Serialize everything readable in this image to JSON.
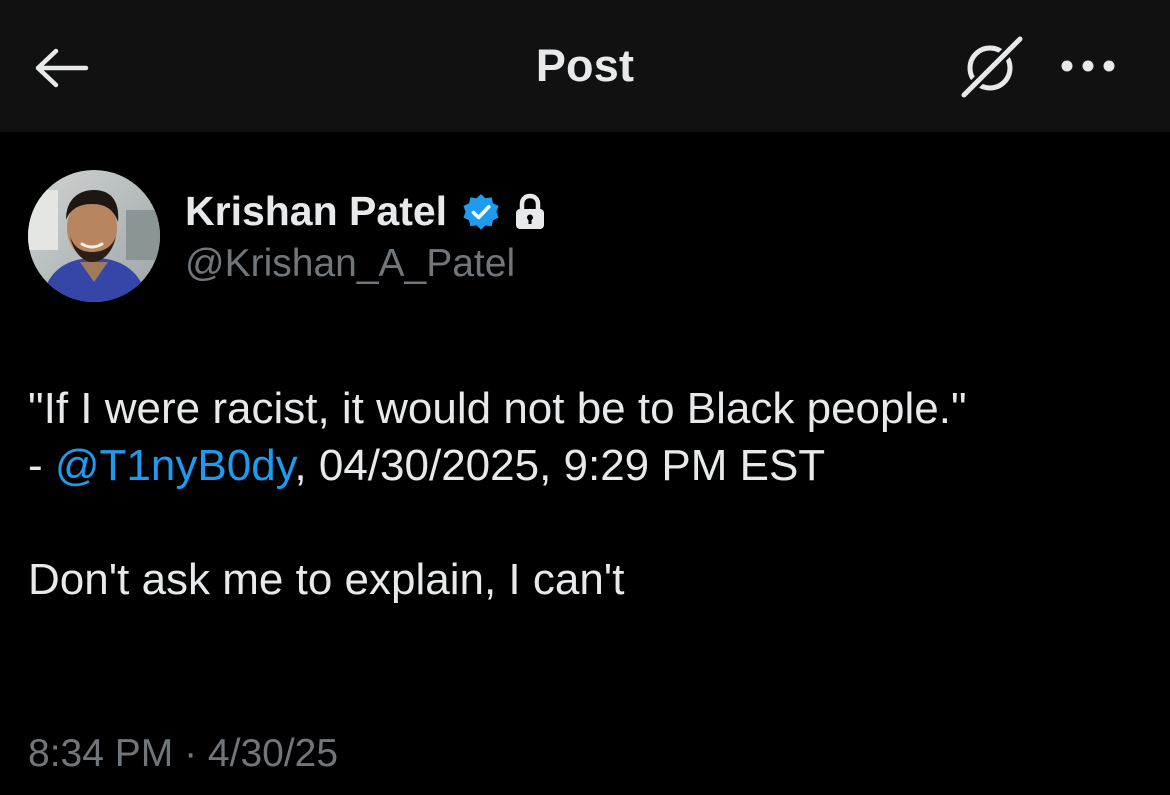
{
  "header": {
    "title": "Post",
    "back_icon": "arrow-left-icon",
    "grok_icon": "grok-icon",
    "more_icon": "more-dots-icon"
  },
  "author": {
    "display_name": "Krishan Patel",
    "handle": "@Krishan_A_Patel",
    "verified_icon": "verified-badge-icon",
    "lock_icon": "lock-icon"
  },
  "tweet": {
    "line1": "\"If I were racist, it would not be to Black people.\"",
    "line2_prefix": "- ",
    "mention": "@T1nyB0dy",
    "line2_suffix": ", 04/30/2025, 9:29 PM EST",
    "line3": "Don't ask me to explain, I can't"
  },
  "meta": {
    "time": "8:34 PM",
    "separator": " · ",
    "date": "4/30/25"
  },
  "colors": {
    "background": "#000000",
    "header_bg": "#111111",
    "text_primary": "#e7e9ea",
    "text_secondary": "#71767b",
    "accent": "#1d9bf0"
  }
}
